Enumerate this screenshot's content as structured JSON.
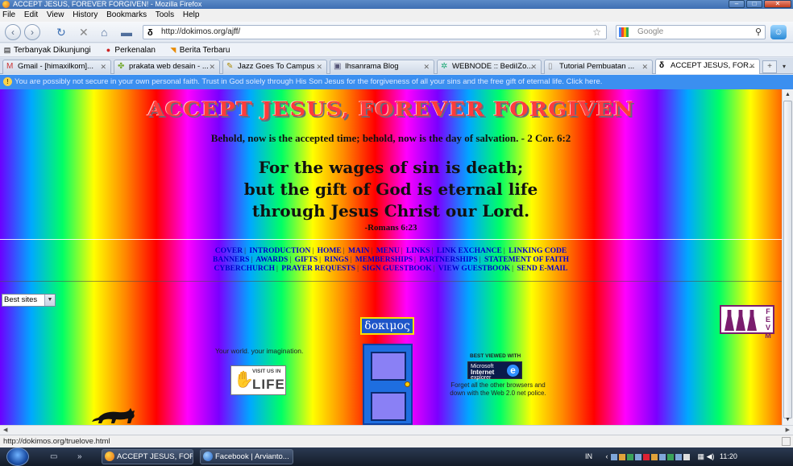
{
  "window": {
    "title": "ACCEPT JESUS, FOREVER FORGIVEN! - Mozilla Firefox"
  },
  "menu": [
    "File",
    "Edit",
    "View",
    "History",
    "Bookmarks",
    "Tools",
    "Help"
  ],
  "nav": {
    "url": "http://dokimos.org/ajff/",
    "search_placeholder": "Google"
  },
  "bookmarks": [
    "Terbanyak Dikunjungi",
    "Perkenalan",
    "Berita Terbaru"
  ],
  "tabs": [
    {
      "label": "Gmail - [himaxilkom]...",
      "icon": "gmail-icon"
    },
    {
      "label": "prakata web desain - ...",
      "icon": "puzzle-icon"
    },
    {
      "label": "Jazz Goes To Campus",
      "icon": "feather-icon"
    },
    {
      "label": "Ihsanrama Blog",
      "icon": "blog-icon"
    },
    {
      "label": "WEBNODE :: BediIZo...",
      "icon": "webnode-icon"
    },
    {
      "label": "Tutorial Pembuatan ...",
      "icon": "page-icon"
    },
    {
      "label": "ACCEPT JESUS, FOR...",
      "icon": "delta-icon",
      "active": true
    }
  ],
  "notification": "You are possibly not secure in your own personal faith. Trust in God solely through His Son Jesus for the forgiveness of all your sins and the free gift of eternal life. Click here.",
  "page": {
    "headline": "ACCEPT JESUS, FOREVER FORGIVEN",
    "subline": "Behold, now is the accepted time; behold, now is the day of salvation. - 2 Cor. 6:2",
    "verse_lines": [
      "For the wages of sin is death;",
      "but the gift of God is eternal life",
      "through Jesus Christ our Lord."
    ],
    "verse_ref": "-Romans 6:23",
    "links_row1": [
      "COVER",
      "INTRODUCTION",
      "HOME",
      "MAIN",
      "MENU",
      "LINKS",
      "LINK EXCHANCE",
      "LINKING CODE"
    ],
    "links_row2": [
      "BANNERS",
      "AWARDS",
      "GIFTS",
      "RINGS",
      "MEMBERSHIPS",
      "PARTNERSHIPS",
      "STATEMENT OF FAITH"
    ],
    "links_row3": [
      "CYBERCHURCH",
      "PRAYER REQUESTS",
      "SIGN GUESTBOOK",
      "VIEW GUESTBOOK",
      "SEND E-MAIL"
    ],
    "select_value": "Best sites",
    "dokimos_label": "δοκιμος",
    "world_text": "Your world. your imagination.",
    "sl_badge_top": "VISIT US IN",
    "sl_badge_main": "LIFE",
    "best_viewed": "BEST VIEWED WITH",
    "ie_badge_line1": "Microsoft",
    "ie_badge_line2": "Internet",
    "ie_badge_line3": "explorer",
    "forget_text": "Forget all the other browsers and down with the Web 2.0 net police.",
    "logo_letters": "F E V M"
  },
  "status": "http://dokimos.org/truelove.html",
  "taskbar": {
    "tasks": [
      {
        "label": "ACCEPT JESUS, FOR...",
        "icon": "firefox-icon"
      },
      {
        "label": "Facebook | Arvianto...",
        "icon": "ie-icon"
      }
    ],
    "lang": "IN",
    "clock": "11:20"
  },
  "colors": {
    "notification_bg": "#3b8ff0",
    "headline": "#ff3b3b",
    "link": "#0000cc"
  }
}
